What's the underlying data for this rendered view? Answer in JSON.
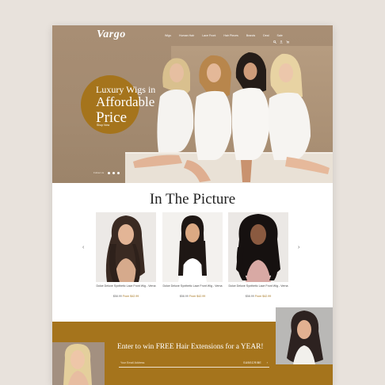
{
  "brand": {
    "logo": "Vargo"
  },
  "nav": {
    "items": [
      "Wigs",
      "Human Hair",
      "Lace Front",
      "Hair Pieces",
      "Brands",
      "Deal",
      "Sale"
    ],
    "icons": [
      "search-icon",
      "account-icon",
      "cart-icon"
    ]
  },
  "hero": {
    "line1": "Luxury Wigs in",
    "line2": "Affordable",
    "line3": "Price",
    "cta": "Shop Now",
    "social_label": "Follow Us"
  },
  "picture": {
    "title": "In The Picture",
    "prev_icon": "‹",
    "next_icon": "›",
    "products": [
      {
        "name": "Dolce Deluxe Synthetic Lace Front Wig - Verna",
        "old_price": "$58.99",
        "sale_price": "From $42.99"
      },
      {
        "name": "Dolce Deluxe Synthetic Lace Front Wig - Verna",
        "old_price": "$58.99",
        "sale_price": "From $42.99"
      },
      {
        "name": "Dolce Deluxe Synthetic Lace Front Wig - Verna",
        "old_price": "$58.99",
        "sale_price": "From $42.99"
      }
    ]
  },
  "subscribe": {
    "title": "Enter to win FREE Hair Extensions for a YEAR!",
    "placeholder": "Your Email Address",
    "button": "SUBSCRIBE",
    "arrow": "›"
  },
  "colors": {
    "accent": "#a5741c",
    "hero_bg": "#a88e74",
    "page_bg": "#e8e2dc"
  }
}
